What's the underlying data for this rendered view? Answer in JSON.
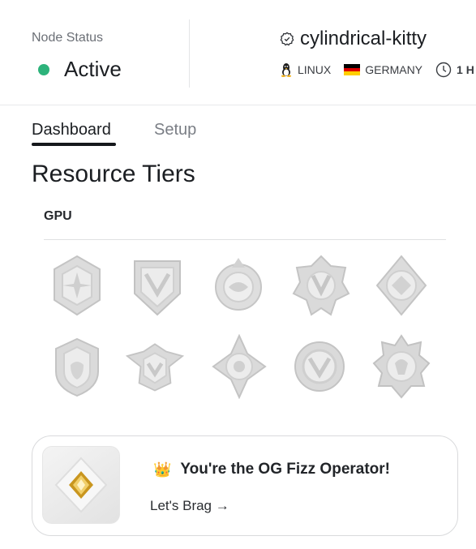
{
  "header": {
    "node_status_label": "Node Status",
    "status_text": "Active",
    "status_color": "#2db37b",
    "node_name": "cylindrical-kitty",
    "os_label": "LINUX",
    "country_label": "GERMANY",
    "time_label": "1 H"
  },
  "tabs": [
    {
      "label": "Dashboard",
      "active": true
    },
    {
      "label": "Setup",
      "active": false
    }
  ],
  "section": {
    "title": "Resource Tiers",
    "gpu_label": "GPU"
  },
  "badges": [
    "badge-tier-1",
    "badge-tier-2",
    "badge-tier-3",
    "badge-tier-4",
    "badge-tier-5",
    "badge-tier-6",
    "badge-tier-7",
    "badge-tier-8",
    "badge-tier-9",
    "badge-tier-10"
  ],
  "card": {
    "title": "You're the OG Fizz Operator!",
    "crown_icon": "crown-icon",
    "link_text": "Let's Brag →"
  }
}
